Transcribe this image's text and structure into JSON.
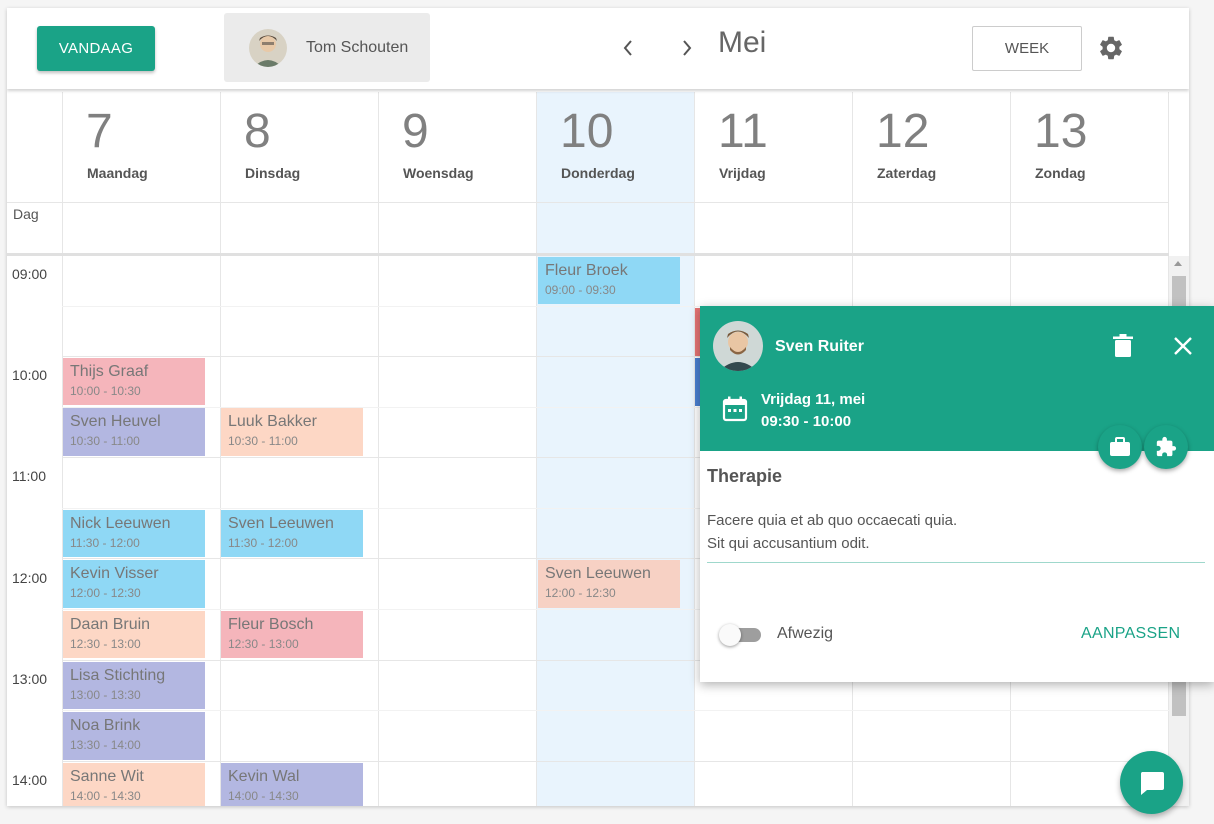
{
  "toolbar": {
    "today_label": "VANDAAG",
    "user_name": "Tom Schouten",
    "prev_icon": "chevron-left-icon",
    "next_icon": "chevron-right-icon",
    "month": "Mei",
    "view_label": "WEEK",
    "settings_icon": "gear-icon"
  },
  "days": [
    {
      "num": "7",
      "name": "Maandag"
    },
    {
      "num": "8",
      "name": "Dinsdag"
    },
    {
      "num": "9",
      "name": "Woensdag"
    },
    {
      "num": "10",
      "name": "Donderdag"
    },
    {
      "num": "11",
      "name": "Vrijdag"
    },
    {
      "num": "12",
      "name": "Zaterdag"
    },
    {
      "num": "13",
      "name": "Zondag"
    }
  ],
  "allday_label": "Dag",
  "hours": [
    "09:00",
    "10:00",
    "11:00",
    "12:00",
    "13:00",
    "14:00"
  ],
  "events": [
    {
      "name": "Fleur Broek",
      "time": "09:00 - 09:30",
      "color": "#8fd8f5"
    },
    {
      "name": "Thijs Graaf",
      "time": "10:00 - 10:30",
      "color": "#f5b5bb"
    },
    {
      "name": "Sven Heuvel",
      "time": "10:30 - 11:00",
      "color": "#b3b7e1"
    },
    {
      "name": "Luuk Bakker",
      "time": "10:30 - 11:00",
      "color": "#fdd7c5"
    },
    {
      "name": "Nick Leeuwen",
      "time": "11:30 - 12:00",
      "color": "#8fd8f5"
    },
    {
      "name": "Sven Leeuwen",
      "time": "11:30 - 12:00",
      "color": "#8fd8f5"
    },
    {
      "name": "Kevin Visser",
      "time": "12:00 - 12:30",
      "color": "#8fd8f5"
    },
    {
      "name": "Sven Leeuwen",
      "time": "12:00 - 12:30",
      "color": "#f7d1c4"
    },
    {
      "name": "Daan Bruin",
      "time": "12:30 - 13:00",
      "color": "#fdd7c5"
    },
    {
      "name": "Fleur Bosch",
      "time": "12:30 - 13:00",
      "color": "#f5b5bb"
    },
    {
      "name": "Lisa Stichting",
      "time": "13:00 - 13:30",
      "color": "#b3b7e1"
    },
    {
      "name": "Noa Brink",
      "time": "13:30 - 14:00",
      "color": "#b3b7e1"
    },
    {
      "name": "Sanne Wit",
      "time": "14:00 - 14:30",
      "color": "#fdd7c5"
    },
    {
      "name": "Kevin Wal",
      "time": "14:00 - 14:30",
      "color": "#b3b7e1"
    }
  ],
  "popup": {
    "name": "Sven Ruiter",
    "date_line": "Vrijdag 11, mei",
    "time_line": "09:30 - 10:00",
    "title": "Therapie",
    "desc_line1": "Facere quia et ab quo occaecati quia.",
    "desc_line2": "Sit qui accusantium odit.",
    "toggle_label": "Afwezig",
    "adjust_label": "AANPASSEN",
    "accent": "#1aa387"
  }
}
